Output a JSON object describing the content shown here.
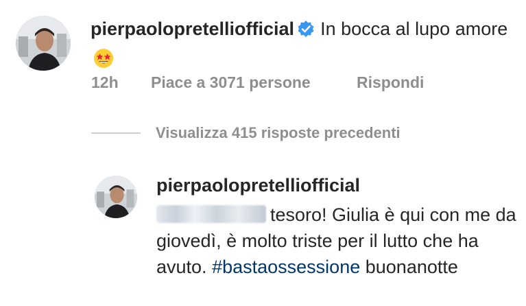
{
  "comment": {
    "username": "pierpaolopretelliofficial",
    "verified": true,
    "text": "In bocca al lupo amore",
    "emoji": "star-struck-emoji",
    "time": "12h",
    "likes": "Piace a 3071 persone",
    "reply_label": "Rispondi"
  },
  "view_replies": {
    "label": "Visualizza 415 risposte precedenti"
  },
  "reply": {
    "username": "pierpaolopretelliofficial",
    "mention": "[blurred username]",
    "text_before_hashtag": "tesoro! Giulia è qui con me da giovedì, è molto triste per il lutto che ha avuto.",
    "hashtag": "#bastaossessione",
    "text_after_hashtag": "buonanotte"
  },
  "colors": {
    "text": "#262626",
    "meta": "#8e8e8e",
    "verified_badge": "#3897f0",
    "hashtag": "#00376b"
  }
}
